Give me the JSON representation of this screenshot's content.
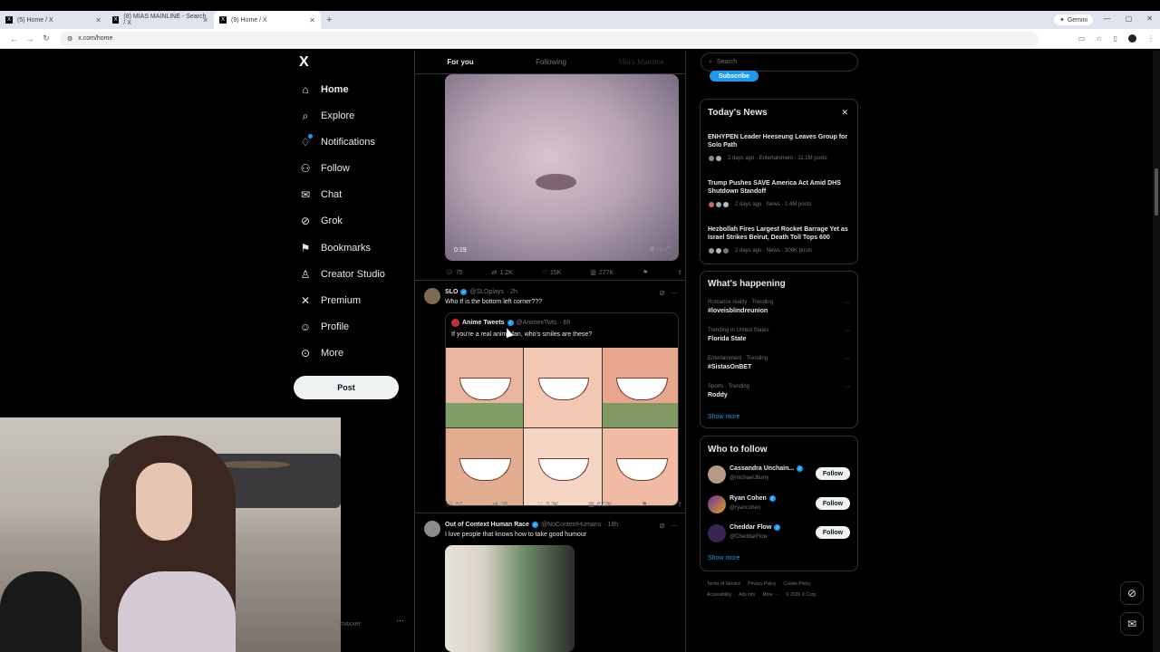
{
  "browser": {
    "tabs": [
      {
        "label": "(5) Home / X"
      },
      {
        "label": "(8) MIAS MAINLINE - Search / X"
      },
      {
        "label": "(9) Home / X"
      }
    ],
    "gemini_label": "Gemini",
    "url": "x.com/home"
  },
  "nav": {
    "logo": "X",
    "items": [
      {
        "label": "Home",
        "icon": "home-icon"
      },
      {
        "label": "Explore",
        "icon": "search-icon"
      },
      {
        "label": "Notifications",
        "icon": "bell-icon"
      },
      {
        "label": "Follow",
        "icon": "person-add-icon"
      },
      {
        "label": "Chat",
        "icon": "mail-icon"
      },
      {
        "label": "Grok",
        "icon": "grok-icon"
      },
      {
        "label": "Bookmarks",
        "icon": "bookmark-icon"
      },
      {
        "label": "Creator Studio",
        "icon": "creator-icon"
      },
      {
        "label": "Premium",
        "icon": "x-icon"
      },
      {
        "label": "Profile",
        "icon": "person-icon"
      },
      {
        "label": "More",
        "icon": "more-icon"
      }
    ],
    "post_label": "Post"
  },
  "webcam": {
    "tag": "maxxer"
  },
  "feed": {
    "tabs": [
      "For you",
      "Following",
      "Mia's Mainline"
    ],
    "video_post": {
      "duration": "0:19",
      "replies": "75",
      "reposts": "1.2K",
      "likes": "15K",
      "views": "277K"
    },
    "post2": {
      "name": "SLO",
      "handle": "@SLOplays",
      "time": "· 2h",
      "text": "Who tf is the bottom left corner???",
      "quote": {
        "name": "Anime Tweets",
        "handle": "@AnimexTwts",
        "time": "· 6h",
        "text": "If you're a real anime fan, who's smiles are these?"
      },
      "replies": "57",
      "reposts": "26",
      "likes": "3.3K",
      "views": "672K"
    },
    "post3": {
      "name": "Out of Context Human Race",
      "handle": "@NoContextHumans",
      "time": "· 18h",
      "text": "I love people that knows how to take good humour"
    }
  },
  "right": {
    "search_placeholder": "Search",
    "subscribe_label": "Subscribe",
    "news": {
      "title": "Today's News",
      "items": [
        {
          "headline": "ENHYPEN Leader Heeseung Leaves Group for Solo Path",
          "meta": "2 days ago · Entertainment · 11.1M posts"
        },
        {
          "headline": "Trump Pushes SAVE America Act Amid DHS Shutdown Standoff",
          "meta": "2 days ago · News · 1.4M posts"
        },
        {
          "headline": "Hezbollah Fires Largest Rocket Barrage Yet as Israel Strikes Beirut, Death Toll Tops 600",
          "meta": "2 days ago · News · 306K posts"
        }
      ]
    },
    "happening": {
      "title": "What's happening",
      "items": [
        {
          "category": "Romance reality · Trending",
          "name": "#loveisblindreunion"
        },
        {
          "category": "Trending in United States",
          "name": "Florida State"
        },
        {
          "category": "Entertainment · Trending",
          "name": "#SistasOnBET"
        },
        {
          "category": "Sports · Trending",
          "name": "Roddy"
        }
      ],
      "show_more": "Show more"
    },
    "who_to_follow": {
      "title": "Who to follow",
      "items": [
        {
          "name": "Cassandra Unchain...",
          "handle": "@michaelJburry",
          "button": "Follow"
        },
        {
          "name": "Ryan Cohen",
          "handle": "@ryancohen",
          "button": "Follow"
        },
        {
          "name": "Cheddar Flow",
          "handle": "@CheddarFlow",
          "button": "Follow"
        }
      ],
      "show_more": "Show more"
    },
    "footer": {
      "row1": [
        "Terms of Service",
        "Privacy Policy",
        "Cookie Policy"
      ],
      "row2": [
        "Accessibility",
        "Ads info",
        "More ···",
        "© 2026 X Corp."
      ]
    }
  }
}
